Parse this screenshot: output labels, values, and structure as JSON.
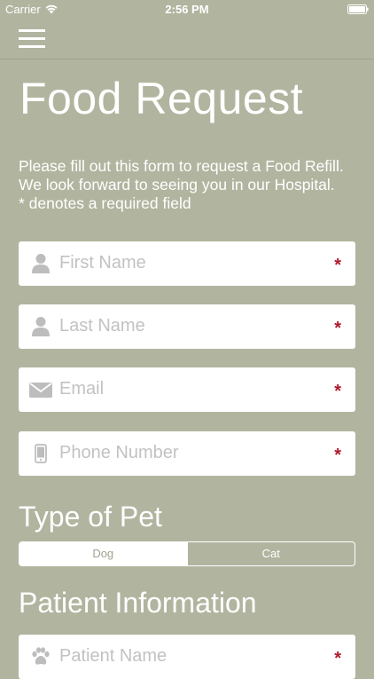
{
  "status_bar": {
    "carrier": "Carrier",
    "time": "2:56 PM"
  },
  "nav": {
    "menu_icon": "hamburger-menu-icon"
  },
  "page": {
    "title": "Food Request",
    "intro": "Please fill out this form to request a Food Refill. We look forward to seeing you in our Hospital.",
    "required_note": "* denotes a required field"
  },
  "fields": [
    {
      "placeholder": "First Name",
      "icon": "person-icon",
      "required_mark": "*"
    },
    {
      "placeholder": "Last Name",
      "icon": "person-icon",
      "required_mark": "*"
    },
    {
      "placeholder": "Email",
      "icon": "envelope-icon",
      "required_mark": "*"
    },
    {
      "placeholder": "Phone Number",
      "icon": "phone-icon",
      "required_mark": "*"
    }
  ],
  "pet_type": {
    "title": "Type of Pet",
    "options": [
      "Dog",
      "Cat"
    ],
    "selected": "Dog"
  },
  "patient": {
    "title": "Patient Information",
    "fields": [
      {
        "placeholder": "Patient Name",
        "icon": "paw-icon",
        "required_mark": "*"
      }
    ]
  },
  "colors": {
    "background": "#b1b59f",
    "required": "#b0192a",
    "placeholder": "#c2c2c2",
    "icon": "#bdbdbd"
  }
}
